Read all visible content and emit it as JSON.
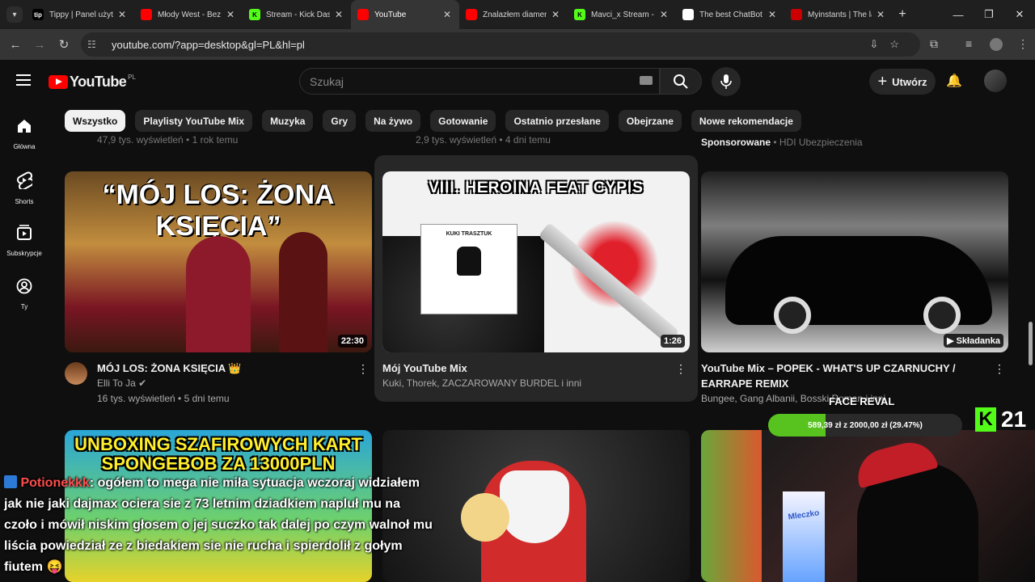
{
  "browser": {
    "tabs": [
      {
        "title": "Tippy | Panel użytkownika",
        "fav": "tip",
        "fav_color": "#000000",
        "active": false
      },
      {
        "title": "Młody West - Bez presji",
        "fav": "",
        "fav_color": "#ff0000",
        "active": false
      },
      {
        "title": "Stream - Kick Dashboard",
        "fav": "K",
        "fav_color": "#53fc18",
        "active": false
      },
      {
        "title": "YouTube",
        "fav": "",
        "fav_color": "#ff0000",
        "active": true
      },
      {
        "title": "Znalazłem diamenty",
        "fav": "",
        "fav_color": "#ff0000",
        "active": false
      },
      {
        "title": "Mavci_x Stream - Watch",
        "fav": "K",
        "fav_color": "#53fc18",
        "active": false
      },
      {
        "title": "The best ChatBot and",
        "fav": "",
        "fav_color": "#ffffff",
        "active": false
      },
      {
        "title": "Myinstants | The largest",
        "fav": "",
        "fav_color": "#cc0000",
        "active": false
      }
    ],
    "new_tab": "+",
    "url": "youtube.com/?app=desktop&gl=PL&hl=pl"
  },
  "youtube": {
    "logo_text": "YouTube",
    "country": "PL",
    "search_placeholder": "Szukaj",
    "create_label": "Utwórz",
    "chips": [
      "Wszystko",
      "Playlisty YouTube Mix",
      "Muzyka",
      "Gry",
      "Na żywo",
      "Gotowanie",
      "Ostatnio przesłane",
      "Obejrzane",
      "Nowe rekomendacje"
    ],
    "sidebar": [
      {
        "label": "Główna",
        "icon": "home-icon"
      },
      {
        "label": "Shorts",
        "icon": "shorts-icon"
      },
      {
        "label": "Subskrypcje",
        "icon": "subscriptions-icon"
      },
      {
        "label": "Ty",
        "icon": "you-icon"
      }
    ],
    "prev_row": {
      "a": "47,9 tys. wyświetleń • 1 rok temu",
      "b": "2,9 tys. wyświetleń • 4 dni temu",
      "c_sponsored": "Sponsorowane",
      "c_sponsor": "• HDI Ubezpieczenia"
    },
    "videos": [
      {
        "thumb_text": "“MÓJ LOS: ŻONA KSIĘCIA”",
        "duration": "22:30",
        "title": "MÓJ LOS: ŻONA KSIĘCIA 👑",
        "channel": "Elli To Ja",
        "meta": "16 tys. wyświetleń • 5 dni temu"
      },
      {
        "thumb_text": "VIII. HEROINA FEAT CYPIS",
        "cover_text": "KUKI TRASZTUK",
        "duration": "1:26",
        "title": "Mój YouTube Mix",
        "channel": "Kuki, Thorek, ZACZAROWANY BURDEL i inni"
      },
      {
        "badge": "Składanka",
        "title": "YouTube Mix – POPEK - WHAT'S UP CZARNUCHY / EARRAPE REMIX",
        "channel": "Bungee, Gang Albanii, Bosski Roman i inni"
      }
    ],
    "row2_thumb_text": "UNBOXING SZAFIROWYCH KART SPONGEBOB ZA 13000PLN",
    "row2_pack_text": "Mleczko"
  },
  "overlay": {
    "chat_user": "Potionekkk",
    "chat_msg": ": ogółem to mega nie miła sytuacja wczoraj widziałem jak nie jaki dajmax ocierа sie z 73 letnim dziadkiem napluł mu na czoło i mówił niskim głosem o jej suczko tak dalej po czym walnoł mu liścia powiedział ze z biedakiem sie nie rucha i spierdolił z gołym fiutem 😝",
    "goal_title": "FACE REVAL",
    "goal_text": "589,39 zł z 2000,00 zł (29.47%)",
    "goal_fraction": 0.2947,
    "kick_letter": "K",
    "kick_count": "21"
  }
}
